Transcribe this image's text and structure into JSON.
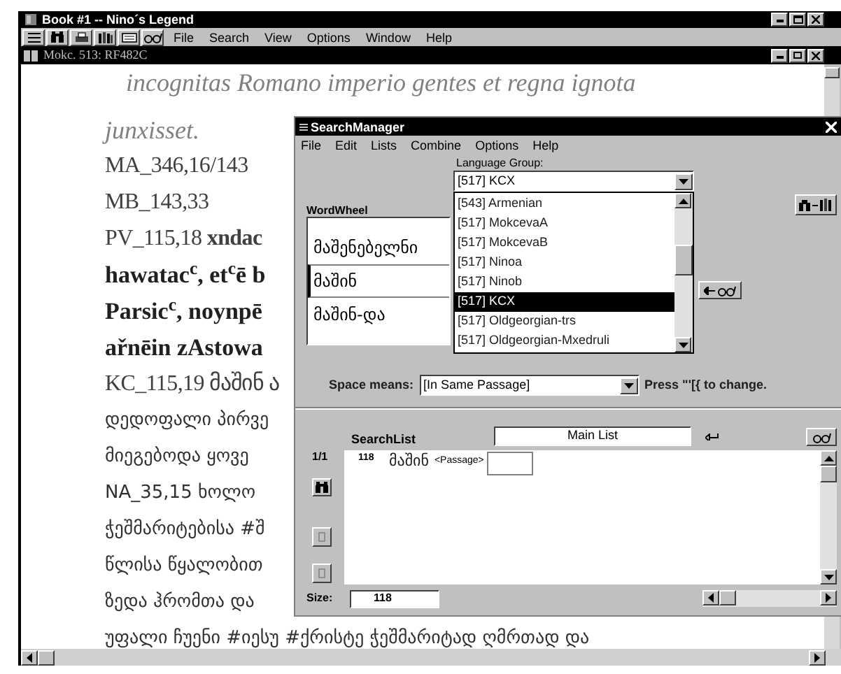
{
  "window": {
    "title": "Book #1 -- Nino´s Legend"
  },
  "menu": [
    "File",
    "Search",
    "View",
    "Options",
    "Window",
    "Help"
  ],
  "document": {
    "title": "Mokc. 513: RF482C",
    "lines": [
      {
        "kind": "italic",
        "text": "incognitas Romano imperio gentes et regna ignota"
      },
      {
        "kind": "italic",
        "text": "junxisset."
      },
      {
        "kind": "plain",
        "text": "MA_346,16/143"
      },
      {
        "kind": "plain",
        "text": "MB_143,33"
      },
      {
        "kind": "plain",
        "text": "PV_115,18 **xndac**"
      },
      {
        "kind": "bold",
        "text": "hawatac$^{c}$, et$^{c}$ē b"
      },
      {
        "kind": "bold",
        "text": "Parsic$^{c}$, noynpē"
      },
      {
        "kind": "bold",
        "text": "ařnēin zAstowa"
      },
      {
        "kind": "plain",
        "text": "KC_115,19 მაშინ ა"
      },
      {
        "kind": "georgian",
        "text": "დედოფალი პირვე"
      },
      {
        "kind": "georgian",
        "text": "მიეგებოდა ყოვე"
      },
      {
        "kind": "georgian",
        "text": "NA_35,15 ხოლო"
      },
      {
        "kind": "georgian",
        "text": "ჭეშმარიტებისა #შ"
      },
      {
        "kind": "georgian",
        "text": "წლისა წყალობით"
      },
      {
        "kind": "georgian",
        "text": "ზედა ჰრომთა და"
      },
      {
        "kind": "georgian",
        "text": "უფალი ჩუენი #იესუ #ქრისტე ჭეშმარიტად ღმრთად და"
      }
    ]
  },
  "search_manager": {
    "title": "SearchManager",
    "menu": [
      "File",
      "Edit",
      "Lists",
      "Combine",
      "Options",
      "Help"
    ],
    "language_group": {
      "label": "Language Group:",
      "value": "[517] KCX",
      "options": [
        {
          "label": "[543] Armenian",
          "selected": false
        },
        {
          "label": "[517] MokcevaA",
          "selected": false
        },
        {
          "label": "[517] MokcevaB",
          "selected": false
        },
        {
          "label": "[517] Ninoa",
          "selected": false
        },
        {
          "label": "[517] Ninob",
          "selected": false
        },
        {
          "label": "[517] KCX",
          "selected": true
        },
        {
          "label": "[517] Oldgeorgian-trs",
          "selected": false
        },
        {
          "label": "[517] Oldgeorgian-Mxedruli",
          "selected": false
        }
      ]
    },
    "word_wheel": {
      "label": "WordWheel",
      "items": [
        {
          "text": "მაშენებელნი",
          "selected": false
        },
        {
          "text": "მაშინ",
          "selected": true
        },
        {
          "text": "მაშინ-და",
          "selected": false
        }
      ]
    },
    "space_means": {
      "label": "Space means:",
      "value": "[In Same Passage]",
      "hint": "Press \"'[{ to change."
    },
    "search_list": {
      "label": "SearchList",
      "list_name": "Main List",
      "counter": "1/1",
      "rows": [
        {
          "count": "118",
          "word": "მაშინ",
          "tag": "<Passage>"
        }
      ]
    },
    "size": {
      "label": "Size:",
      "value": "118"
    }
  }
}
